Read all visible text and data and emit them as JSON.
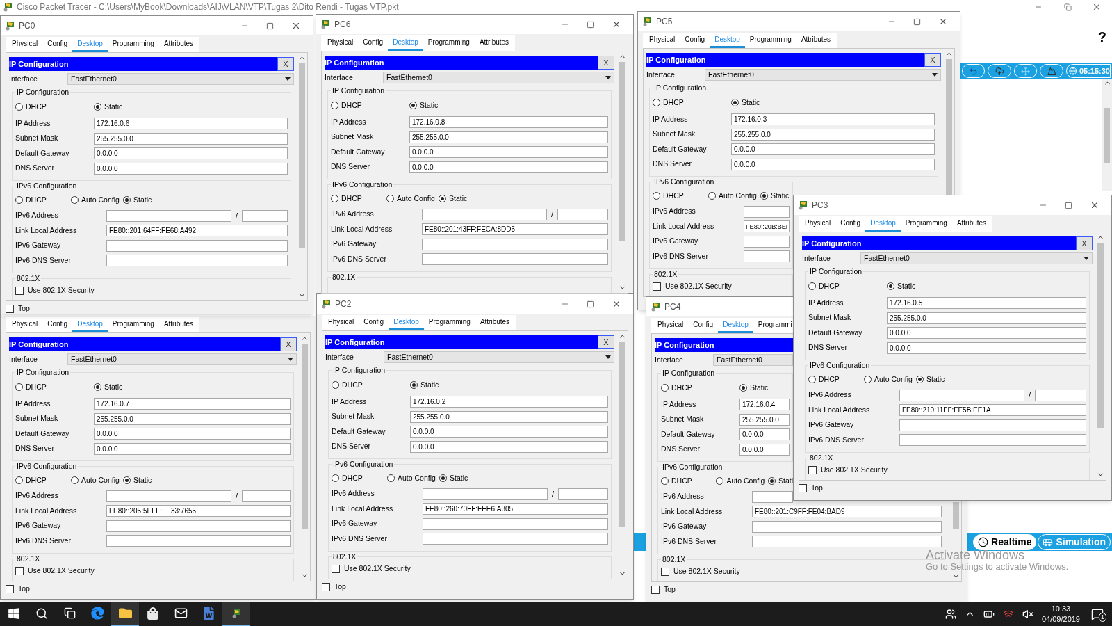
{
  "app": {
    "title": "Cisco Packet Tracer - C:\\Users\\MyBook\\Downloads\\AIJ\\VLAN\\VTP\\Tugas 2\\Dito Rendi - Tugas VTP.pkt",
    "help": "?",
    "clock": "05:15:30",
    "modes": [
      {
        "label": "Realtime",
        "selected": true
      },
      {
        "label": "Simulation",
        "selected": false
      }
    ]
  },
  "windows": [
    {
      "title": "PC0",
      "title_buttons": true,
      "tabs": [
        {
          "label": "Physical",
          "selected": false
        },
        {
          "label": "Config",
          "selected": false
        },
        {
          "label": "Desktop",
          "selected": true
        },
        {
          "label": "Programming",
          "selected": false
        },
        {
          "label": "Attributes",
          "selected": false
        }
      ],
      "panel_title": "IP Configuration",
      "close_label": "X",
      "interface": {
        "label": "Interface",
        "value": "FastEthernet0"
      },
      "ipv4": {
        "legend": "IP Configuration",
        "options": [
          {
            "label": "DHCP",
            "selected": false
          },
          {
            "label": "Static",
            "selected": true
          }
        ],
        "fields": [
          {
            "label": "IP Address",
            "value": "172.16.0.6"
          },
          {
            "label": "Subnet Mask",
            "value": "255.255.0.0"
          },
          {
            "label": "Default Gateway",
            "value": "0.0.0.0"
          },
          {
            "label": "DNS Server",
            "value": "0.0.0.0"
          }
        ]
      },
      "ipv6": {
        "legend": "IPv6 Configuration",
        "options": [
          {
            "label": "DHCP",
            "selected": false
          },
          {
            "label": "Auto Config",
            "selected": false
          },
          {
            "label": "Static",
            "selected": true
          }
        ],
        "address": {
          "label": "IPv6 Address",
          "separator": "/"
        },
        "fields": [
          {
            "label": "Link Local Address",
            "value": "FE80::201:64FF:FE68:A492"
          },
          {
            "label": "IPv6 Gateway"
          },
          {
            "label": "IPv6 DNS Server"
          }
        ]
      },
      "dot1x": {
        "legend": "802.1X",
        "label": "Use 802.1X Security",
        "checked": false
      },
      "top": {
        "label": "Top",
        "checked": false
      }
    },
    {
      "title": "PC6",
      "title_buttons": true,
      "tabs": [
        {
          "label": "Physical",
          "selected": false
        },
        {
          "label": "Config",
          "selected": false
        },
        {
          "label": "Desktop",
          "selected": true
        },
        {
          "label": "Programming",
          "selected": false
        },
        {
          "label": "Attributes",
          "selected": false
        }
      ],
      "panel_title": "IP Configuration",
      "close_label": "X",
      "interface": {
        "label": "Interface",
        "value": "FastEthernet0"
      },
      "ipv4": {
        "legend": "IP Configuration",
        "options": [
          {
            "label": "DHCP",
            "selected": false
          },
          {
            "label": "Static",
            "selected": true
          }
        ],
        "fields": [
          {
            "label": "IP Address",
            "value": "172.16.0.8"
          },
          {
            "label": "Subnet Mask",
            "value": "255.255.0.0"
          },
          {
            "label": "Default Gateway",
            "value": "0.0.0.0"
          },
          {
            "label": "DNS Server",
            "value": "0.0.0.0"
          }
        ]
      },
      "ipv6": {
        "legend": "IPv6 Configuration",
        "options": [
          {
            "label": "DHCP",
            "selected": false
          },
          {
            "label": "Auto Config",
            "selected": false
          },
          {
            "label": "Static",
            "selected": true
          }
        ],
        "address": {
          "label": "IPv6 Address",
          "separator": "/"
        },
        "fields": [
          {
            "label": "Link Local Address",
            "value": "FE80::201:43FF:FECA:8DD5"
          },
          {
            "label": "IPv6 Gateway"
          },
          {
            "label": "IPv6 DNS Server"
          }
        ]
      },
      "dot1x": {
        "legend": "802.1X"
      }
    },
    {
      "title": "PC5",
      "title_buttons": true,
      "tabs": [
        {
          "label": "Physical",
          "selected": false
        },
        {
          "label": "Config",
          "selected": false
        },
        {
          "label": "Desktop",
          "selected": true
        },
        {
          "label": "Programming",
          "selected": false
        },
        {
          "label": "Attributes",
          "selected": false
        }
      ],
      "panel_title": "IP Configuration",
      "close_label": "X",
      "interface": {
        "label": "Interface",
        "value": "FastEthernet0"
      },
      "ipv4": {
        "legend": "IP Configuration",
        "options": [
          {
            "label": "DHCP",
            "selected": false
          },
          {
            "label": "Static",
            "selected": true
          }
        ],
        "fields": [
          {
            "label": "IP Address",
            "value": "172.16.0.3"
          },
          {
            "label": "Subnet Mask",
            "value": "255.255.0.0"
          },
          {
            "label": "Default Gateway",
            "value": "0.0.0.0"
          },
          {
            "label": "DNS Server",
            "value": "0.0.0.0"
          }
        ]
      },
      "ipv6": {
        "legend": "IPv6 Configuration",
        "options": [
          {
            "label": "DHCP",
            "selected": false
          },
          {
            "label": "Auto Config",
            "selected": false
          },
          {
            "label": "Static",
            "selected": true
          }
        ],
        "address": {
          "label": "IPv6 Address"
        },
        "fields": [
          {
            "label": "Link Local Address",
            "value": "FE80::20B:BEF"
          },
          {
            "label": "IPv6 Gateway"
          },
          {
            "label": "IPv6 DNS Server"
          }
        ]
      },
      "dot1x": {
        "legend": "802.1X",
        "label": "Use 802.1X Security",
        "checked": false
      }
    },
    {
      "title": "PC3",
      "title_buttons": true,
      "tabs": [
        {
          "label": "Physical",
          "selected": false
        },
        {
          "label": "Config",
          "selected": false
        },
        {
          "label": "Desktop",
          "selected": true
        },
        {
          "label": "Programming",
          "selected": false
        },
        {
          "label": "Attributes",
          "selected": false
        }
      ],
      "panel_title": "IP Configuration",
      "close_label": "X",
      "interface": {
        "label": "Interface",
        "value": "FastEthernet0"
      },
      "ipv4": {
        "legend": "IP Configuration",
        "options": [
          {
            "label": "DHCP",
            "selected": false
          },
          {
            "label": "Static",
            "selected": true
          }
        ],
        "fields": [
          {
            "label": "IP Address",
            "value": "172.16.0.5"
          },
          {
            "label": "Subnet Mask",
            "value": "255.255.0.0"
          },
          {
            "label": "Default Gateway",
            "value": "0.0.0.0"
          },
          {
            "label": "DNS Server",
            "value": "0.0.0.0"
          }
        ]
      },
      "ipv6": {
        "legend": "IPv6 Configuration",
        "options": [
          {
            "label": "DHCP",
            "selected": false
          },
          {
            "label": "Auto Config",
            "selected": false
          },
          {
            "label": "Static",
            "selected": true
          }
        ],
        "address": {
          "label": "IPv6 Address",
          "separator": "/"
        },
        "fields": [
          {
            "label": "Link Local Address",
            "value": "FE80::210:11FF:FE5B:EE1A"
          },
          {
            "label": "IPv6 Gateway"
          },
          {
            "label": "IPv6 DNS Server"
          }
        ]
      },
      "dot1x": {
        "legend": "802.1X",
        "label": "Use 802.1X Security",
        "checked": false
      },
      "top": {
        "label": "Top",
        "checked": false
      }
    },
    {
      "title_buttons": false,
      "tabs": [
        {
          "label": "Physical",
          "selected": false
        },
        {
          "label": "Config",
          "selected": false
        },
        {
          "label": "Desktop",
          "selected": true
        },
        {
          "label": "Programming",
          "selected": false
        },
        {
          "label": "Attributes",
          "selected": false
        }
      ],
      "panel_title": "IP Configuration",
      "close_label": "X",
      "interface": {
        "label": "Interface",
        "value": "FastEthernet0"
      },
      "ipv4": {
        "legend": "IP Configuration",
        "options": [
          {
            "label": "DHCP",
            "selected": false
          },
          {
            "label": "Static",
            "selected": true
          }
        ],
        "fields": [
          {
            "label": "IP Address",
            "value": "172.16.0.7"
          },
          {
            "label": "Subnet Mask",
            "value": "255.255.0.0"
          },
          {
            "label": "Default Gateway",
            "value": "0.0.0.0"
          },
          {
            "label": "DNS Server",
            "value": "0.0.0.0"
          }
        ]
      },
      "ipv6": {
        "legend": "IPv6 Configuration",
        "options": [
          {
            "label": "DHCP",
            "selected": false
          },
          {
            "label": "Auto Config",
            "selected": false
          },
          {
            "label": "Static",
            "selected": true
          }
        ],
        "address": {
          "label": "IPv6 Address",
          "separator": "/"
        },
        "fields": [
          {
            "label": "Link Local Address",
            "value": "FE80::205:5EFF:FE33:7655"
          },
          {
            "label": "IPv6 Gateway"
          },
          {
            "label": "IPv6 DNS Server"
          }
        ]
      },
      "dot1x": {
        "legend": "802.1X",
        "label": "Use 802.1X Security",
        "checked": false
      },
      "top": {
        "label": "Top",
        "checked": false
      }
    },
    {
      "title": "PC2",
      "title_buttons": true,
      "tabs": [
        {
          "label": "Physical",
          "selected": false
        },
        {
          "label": "Config",
          "selected": false
        },
        {
          "label": "Desktop",
          "selected": true
        },
        {
          "label": "Programming",
          "selected": false
        },
        {
          "label": "Attributes",
          "selected": false
        }
      ],
      "panel_title": "IP Configuration",
      "close_label": "X",
      "interface": {
        "label": "Interface",
        "value": "FastEthernet0"
      },
      "ipv4": {
        "legend": "IP Configuration",
        "options": [
          {
            "label": "DHCP",
            "selected": false
          },
          {
            "label": "Static",
            "selected": true
          }
        ],
        "fields": [
          {
            "label": "IP Address",
            "value": "172.16.0.2"
          },
          {
            "label": "Subnet Mask",
            "value": "255.255.0.0"
          },
          {
            "label": "Default Gateway",
            "value": "0.0.0.0"
          },
          {
            "label": "DNS Server",
            "value": "0.0.0.0"
          }
        ]
      },
      "ipv6": {
        "legend": "IPv6 Configuration",
        "options": [
          {
            "label": "DHCP",
            "selected": false
          },
          {
            "label": "Auto Config",
            "selected": false
          },
          {
            "label": "Static",
            "selected": true
          }
        ],
        "address": {
          "label": "IPv6 Address",
          "separator": "/"
        },
        "fields": [
          {
            "label": "Link Local Address",
            "value": "FE80::260:70FF:FEE6:A305"
          },
          {
            "label": "IPv6 Gateway"
          },
          {
            "label": "IPv6 DNS Server"
          }
        ]
      },
      "dot1x": {
        "legend": "802.1X",
        "label": "Use 802.1X Security",
        "checked": false
      },
      "top": {
        "label": "Top",
        "checked": false
      }
    },
    {
      "title": "PC4",
      "title_buttons": false,
      "tabs": [
        {
          "label": "Physical",
          "selected": false
        },
        {
          "label": "Config",
          "selected": false
        },
        {
          "label": "Desktop",
          "selected": true
        },
        {
          "label": "Programmi",
          "selected": false
        }
      ],
      "panel_title": "IP Configuration",
      "interface": {
        "label": "Interface",
        "value": "FastEthernet0"
      },
      "ipv4": {
        "legend": "IP Configuration",
        "options": [
          {
            "label": "DHCP",
            "selected": false
          },
          {
            "label": "Static",
            "selected": true
          }
        ],
        "fields": [
          {
            "label": "IP Address",
            "value": "172.16.0.4"
          },
          {
            "label": "Subnet Mask",
            "value": "255.255.0.0"
          },
          {
            "label": "Default Gateway",
            "value": "0.0.0.0"
          },
          {
            "label": "DNS Server",
            "value": "0.0.0.0"
          }
        ]
      },
      "ipv6": {
        "legend": "IPv6 Configuration",
        "options": [
          {
            "label": "DHCP",
            "selected": false
          },
          {
            "label": "Auto Config",
            "selected": false
          },
          {
            "label": "Stati",
            "selected": true
          }
        ],
        "address": {
          "label": "IPv6 Address"
        },
        "fields": [
          {
            "label": "Link Local Address",
            "value": "FE80::201:C9FF:FE04:BAD9"
          },
          {
            "label": "IPv6 Gateway"
          },
          {
            "label": "IPv6 DNS Server"
          }
        ]
      },
      "dot1x": {
        "legend": "802.1X",
        "label": "Use 802.1X Security",
        "checked": false
      },
      "top": {
        "label": "Top",
        "checked": false
      }
    }
  ],
  "activation": {
    "title": "Activate Windows",
    "text": "Go to Settings to activate Windows."
  },
  "taskbar": {
    "apps": [
      {
        "kind": "start",
        "active": false
      },
      {
        "kind": "search",
        "active": false
      },
      {
        "kind": "taskview",
        "active": false
      },
      {
        "kind": "edge",
        "active": false
      },
      {
        "kind": "explorer",
        "active": true
      },
      {
        "kind": "store",
        "active": false
      },
      {
        "kind": "mail",
        "active": false
      },
      {
        "kind": "word",
        "active": false
      },
      {
        "kind": "packettracer",
        "active": true
      }
    ],
    "time": "10:33",
    "date": "04/09/2019",
    "notifications": "1"
  }
}
